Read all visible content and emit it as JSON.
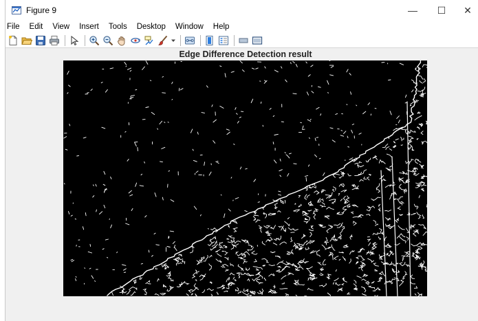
{
  "window": {
    "title": "Figure 9",
    "controls": {
      "minimize": "—",
      "maximize": "☐",
      "close": "✕"
    }
  },
  "menu": [
    "File",
    "Edit",
    "View",
    "Insert",
    "Tools",
    "Desktop",
    "Window",
    "Help"
  ],
  "toolbar": {
    "groups": [
      [
        "new-figure-icon",
        "open-file-icon",
        "save-icon",
        "print-icon"
      ],
      [
        "pointer-icon"
      ],
      [
        "zoom-in-icon",
        "zoom-out-icon",
        "pan-icon",
        "rotate-3d-icon",
        "data-cursor-icon",
        "brush-icon",
        "brush-dropdown-icon"
      ],
      [
        "link-plot-icon"
      ],
      [
        "colorbar-icon",
        "legend-icon"
      ],
      [
        "hide-plot-tools-icon",
        "show-plot-tools-icon"
      ]
    ]
  },
  "figure": {
    "title": "Edge Difference Detection result",
    "image": {
      "background": "#000000",
      "foreground": "#ffffff"
    }
  }
}
